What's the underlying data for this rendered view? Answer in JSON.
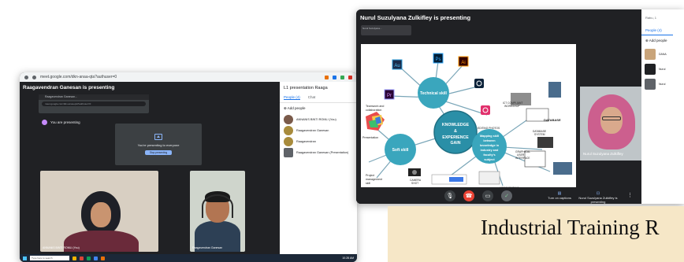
{
  "left_screenshot": {
    "browser": {
      "url": "meet.google.com/dkn-anaa-qta?authuser=0"
    },
    "presenting_title": "Raagavendran Ganesan is presenting",
    "inner_browser": {
      "tab": "Raagavendran Ganesan...",
      "url": "meet.google.com/dkn-anaa-qta?authuser=0"
    },
    "you_are_presenting": "You are presenting",
    "present_box": {
      "message": "You're presenting to everyone",
      "stop_button": "Stop presenting"
    },
    "tiles": [
      {
        "name": "ANNANIS BINTI ROMLI (You)"
      },
      {
        "name": "Raagavendran Ganesan"
      }
    ],
    "panel": {
      "title": "L1 presentation Raaga",
      "tabs": [
        {
          "label": "People (4)",
          "active": true
        },
        {
          "label": "Chat",
          "active": false
        }
      ],
      "add_people": "Add people",
      "people": [
        {
          "name": "ANNANIS BINTI ROMLI (You)",
          "color": "#7a5a4a"
        },
        {
          "name": "Raagavendran Ganesan",
          "color": "#a88b3c"
        },
        {
          "name": "Raagavendran",
          "color": "#a88b3c"
        },
        {
          "name": "Raagavendran Ganesan (Presentation)",
          "color": "#5f6368"
        }
      ]
    },
    "taskbar": {
      "search": "Type here to search",
      "time": "10:28 AM"
    }
  },
  "right_screenshot": {
    "presenting_title": "Nurul Suzulyana Zulkifley is presenting",
    "tab_preview": "Nurul Suzulyana...",
    "slide": {
      "center": "KNOWLEDGE & EXPERIENCE GAIN",
      "technical": "Technical skill",
      "soft": "Soft skill",
      "mapping": "Mapping skill between knowledge in industry and faculty's subject",
      "left_labels": [
        "Teamwork and collaboration",
        "Presentation",
        "Project management skill"
      ],
      "right_labels": [
        "ICT COMPLIANT WORKSHOP",
        "DATABASE",
        "DATABASE SYSTEM",
        "GRAPHICAL USER INTERFACE",
        "EDITING PHOTOS",
        "CAMERA SHOT",
        "VIDEO EDITING"
      ],
      "app_icons": [
        "Au",
        "Ps",
        "Ai",
        "Pr"
      ]
    },
    "video": {
      "name": "Nurul Suzulyana Zulkifley"
    },
    "controls": {
      "captions": "Turn on captions",
      "presenting": "Nurul Suzulyana Zulkifley is presenting"
    },
    "panel": {
      "date": "Rabu, 1",
      "tab": "People (4)",
      "add_people": "Add people",
      "people": [
        {
          "name": "DANA",
          "color": "#c9a47a"
        },
        {
          "name": "Nurul",
          "color": "#202124"
        },
        {
          "name": "Nurul",
          "color": "#5f6368"
        }
      ]
    }
  },
  "heading": "Industrial Training R"
}
